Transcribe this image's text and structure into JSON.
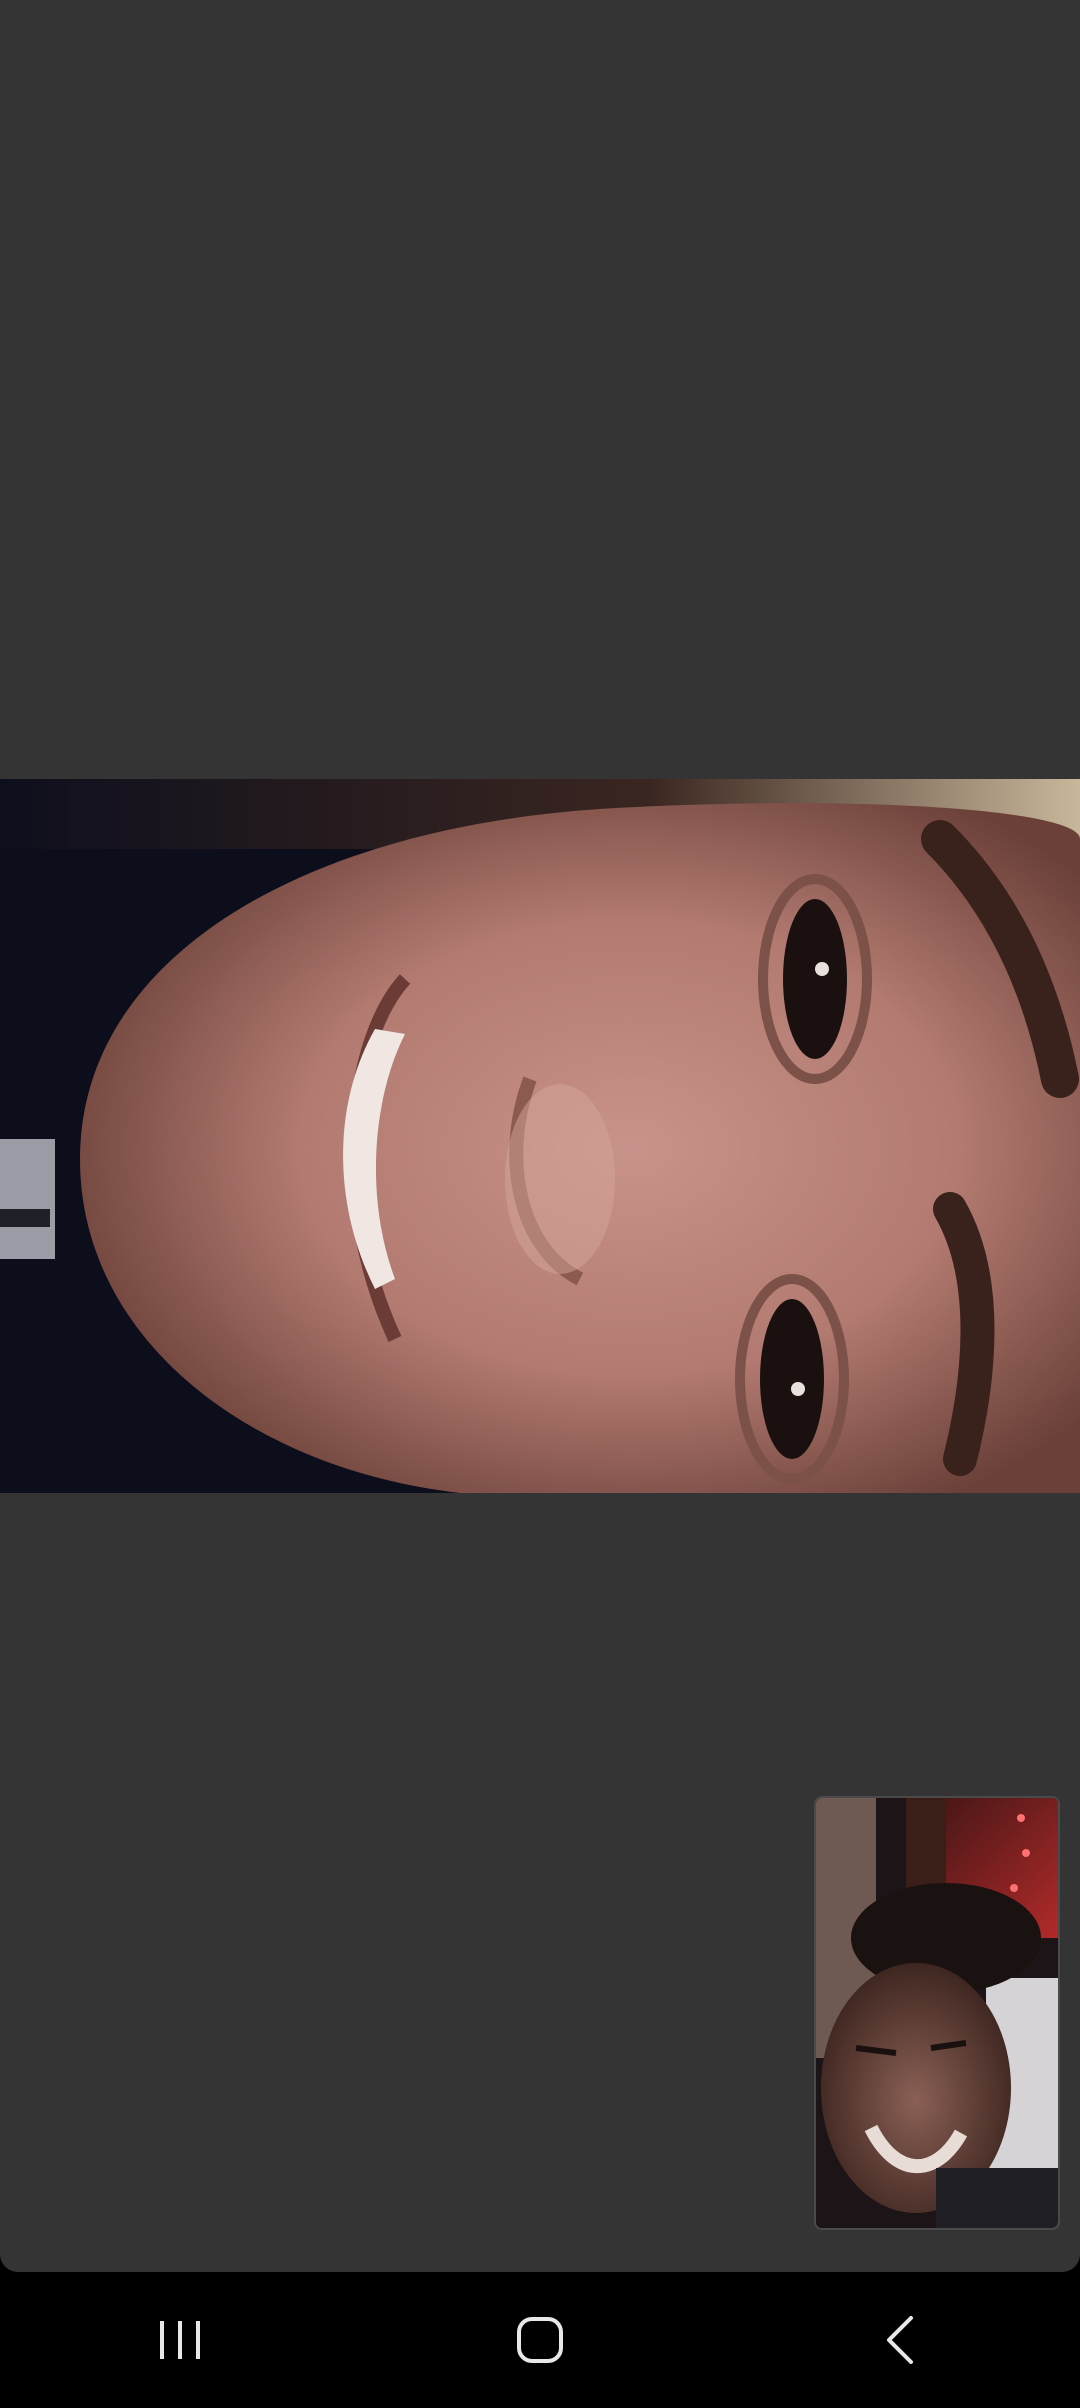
{
  "call": {
    "remote_video": "remote-participant-video",
    "self_view": "local-camera-preview"
  },
  "navigation_bar": {
    "buttons": [
      {
        "name": "recent-apps",
        "icon": "recent-apps-icon"
      },
      {
        "name": "home",
        "icon": "home-icon"
      },
      {
        "name": "back",
        "icon": "back-icon"
      }
    ]
  },
  "colors": {
    "background": "#343434",
    "navbar": "#000000",
    "nav_icon": "#e8e8e8"
  }
}
